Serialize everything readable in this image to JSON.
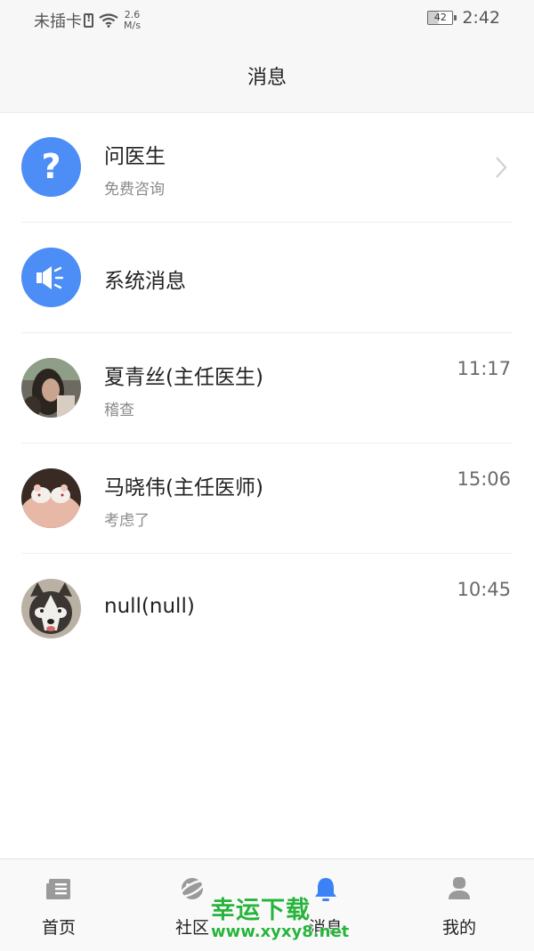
{
  "status_bar": {
    "carrier": "未插卡",
    "speed_value": "2.6",
    "speed_unit": "M/s",
    "battery": "42",
    "time": "2:42"
  },
  "header": {
    "title": "消息"
  },
  "messages": [
    {
      "name": "问医生",
      "subtitle": "免费咨询",
      "time": "",
      "avatar": "question-icon",
      "avatar_color": "#4c8df6"
    },
    {
      "name": "系统消息",
      "subtitle": "",
      "time": "",
      "avatar": "speaker-icon",
      "avatar_color": "#4c8df6"
    },
    {
      "name": "夏青丝(主任医生)",
      "subtitle": "稽查",
      "time": "11:17",
      "avatar": "photo-woman"
    },
    {
      "name": "马晓伟(主任医师)",
      "subtitle": "考虑了",
      "time": "15:06",
      "avatar": "photo-mice"
    },
    {
      "name": "null(null)",
      "subtitle": "",
      "time": "10:45",
      "avatar": "photo-husky"
    }
  ],
  "bottom_nav": {
    "items": [
      {
        "label": "首页",
        "icon": "news-icon",
        "active": false
      },
      {
        "label": "社区",
        "icon": "planet-icon",
        "active": false
      },
      {
        "label": "消息",
        "icon": "bell-icon",
        "active": true
      },
      {
        "label": "我的",
        "icon": "user-icon",
        "active": false
      }
    ],
    "active_color": "#3b82f6",
    "inactive_color": "#9a9a9a"
  },
  "watermark": {
    "text": "幸运下载",
    "url": "www.xyxy8.net"
  }
}
